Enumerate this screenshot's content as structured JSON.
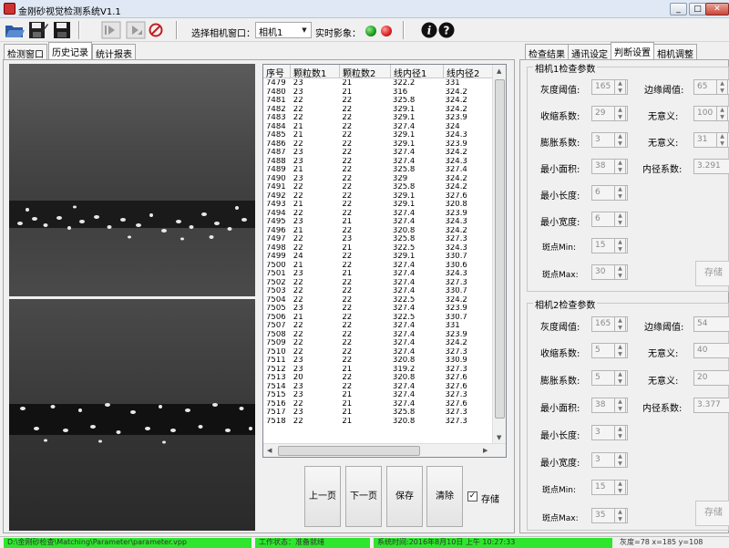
{
  "window": {
    "title": "金刚砂视觉检测系统V1.1"
  },
  "toolbar": {
    "camera_label": "选择相机窗口：",
    "camera_value": "相机1",
    "realtime_label": "实时影象："
  },
  "left_tabs": [
    "检测窗口",
    "历史记录",
    "统计报表"
  ],
  "grid": {
    "columns": [
      "序号",
      "颗粒数1",
      "颗粒数2",
      "线内径1",
      "线内径2"
    ],
    "rows": [
      [
        "7479",
        "23",
        "21",
        "322.2",
        "331"
      ],
      [
        "7480",
        "23",
        "21",
        "316",
        "324.2"
      ],
      [
        "7481",
        "22",
        "22",
        "325.8",
        "324.2"
      ],
      [
        "7482",
        "22",
        "22",
        "329.1",
        "324.2"
      ],
      [
        "7483",
        "22",
        "22",
        "329.1",
        "323.9"
      ],
      [
        "7484",
        "21",
        "22",
        "327.4",
        "324"
      ],
      [
        "7485",
        "21",
        "22",
        "329.1",
        "324.3"
      ],
      [
        "7486",
        "22",
        "22",
        "329.1",
        "323.9"
      ],
      [
        "7487",
        "23",
        "22",
        "327.4",
        "324.2"
      ],
      [
        "7488",
        "23",
        "22",
        "327.4",
        "324.3"
      ],
      [
        "7489",
        "21",
        "22",
        "325.8",
        "327.4"
      ],
      [
        "7490",
        "23",
        "22",
        "329",
        "324.2"
      ],
      [
        "7491",
        "22",
        "22",
        "325.8",
        "324.2"
      ],
      [
        "7492",
        "22",
        "22",
        "329.1",
        "327.6"
      ],
      [
        "7493",
        "21",
        "22",
        "329.1",
        "320.8"
      ],
      [
        "7494",
        "22",
        "22",
        "327.4",
        "323.9"
      ],
      [
        "7495",
        "23",
        "21",
        "327.4",
        "324.3"
      ],
      [
        "7496",
        "21",
        "22",
        "320.8",
        "324.2"
      ],
      [
        "7497",
        "22",
        "23",
        "325.8",
        "327.3"
      ],
      [
        "7498",
        "22",
        "21",
        "322.5",
        "324.3"
      ],
      [
        "7499",
        "24",
        "22",
        "329.1",
        "330.7"
      ],
      [
        "7500",
        "21",
        "22",
        "327.4",
        "330.6"
      ],
      [
        "7501",
        "23",
        "21",
        "327.4",
        "324.3"
      ],
      [
        "7502",
        "22",
        "22",
        "327.4",
        "327.3"
      ],
      [
        "7503",
        "22",
        "22",
        "327.4",
        "330.7"
      ],
      [
        "7504",
        "22",
        "22",
        "322.5",
        "324.2"
      ],
      [
        "7505",
        "23",
        "22",
        "327.4",
        "323.9"
      ],
      [
        "7506",
        "21",
        "22",
        "322.5",
        "330.7"
      ],
      [
        "7507",
        "22",
        "22",
        "327.4",
        "331"
      ],
      [
        "7508",
        "22",
        "22",
        "327.4",
        "323.9"
      ],
      [
        "7509",
        "22",
        "22",
        "327.4",
        "324.2"
      ],
      [
        "7510",
        "22",
        "22",
        "327.4",
        "327.3"
      ],
      [
        "7511",
        "23",
        "22",
        "320.8",
        "330.9"
      ],
      [
        "7512",
        "23",
        "21",
        "319.2",
        "327.3"
      ],
      [
        "7513",
        "20",
        "22",
        "320.8",
        "327.6"
      ],
      [
        "7514",
        "23",
        "22",
        "327.4",
        "327.6"
      ],
      [
        "7515",
        "23",
        "21",
        "327.4",
        "327.3"
      ],
      [
        "7516",
        "22",
        "21",
        "327.4",
        "327.6"
      ],
      [
        "7517",
        "23",
        "21",
        "325.8",
        "327.3"
      ],
      [
        "7518",
        "22",
        "21",
        "320.8",
        "327.3"
      ]
    ]
  },
  "bottom_buttons": {
    "prev": "上一页",
    "next": "下一页",
    "save": "保存",
    "clear": "清除",
    "store": "存储",
    "store_checked": true
  },
  "right_tabs": [
    "检查结果",
    "通讯设定",
    "判断设置",
    "相机调整"
  ],
  "cam1": {
    "legend": "相机1检查参数",
    "gray_label": "灰度阈值:",
    "gray_value": "165",
    "edge_label": "边缘阈值:",
    "edge_value": "65",
    "shrink_label": "收缩系数:",
    "shrink_value": "29",
    "nomean1_label": "无意义:",
    "nomean1_value": "100",
    "expand_label": "膨胀系数:",
    "expand_value": "3",
    "nomean2_label": "无意义:",
    "nomean2_value": "31",
    "minarea_label": "最小面积:",
    "minarea_value": "38",
    "innercoef_label": "内径系数:",
    "innercoef_value": "3.291",
    "minlen_label": "最小长度:",
    "minlen_value": "6",
    "minwidth_label": "最小宽度:",
    "minwidth_value": "6",
    "spotmin_label": "斑点Min:",
    "spotmin_value": "15",
    "spotmax_label": "斑点Max:",
    "spotmax_value": "30",
    "save_label": "存储"
  },
  "cam2": {
    "legend": "相机2检查参数",
    "gray_label": "灰度阈值:",
    "gray_value": "165",
    "edge_label": "边缘阈值:",
    "edge_value": "54",
    "shrink_label": "收缩系数:",
    "shrink_value": "5",
    "nomean1_label": "无意义:",
    "nomean1_value": "40",
    "expand_label": "膨胀系数:",
    "expand_value": "5",
    "nomean2_label": "无意义:",
    "nomean2_value": "20",
    "minarea_label": "最小面积:",
    "minarea_value": "38",
    "innercoef_label": "内径系数:",
    "innercoef_value": "3.377",
    "minlen_label": "最小长度:",
    "minlen_value": "3",
    "minwidth_label": "最小宽度:",
    "minwidth_value": "3",
    "spotmin_label": "斑点Min:",
    "spotmin_value": "15",
    "spotmax_label": "斑点Max:",
    "spotmax_value": "35",
    "save_label": "存储"
  },
  "status": {
    "path": "D:\\金刚砂检查\\Matching\\Parameter\\parameter.vpp",
    "mode": "工作状态：准备就绪",
    "time": "系统时间:2016年8月10日 上午 10:27:33",
    "coord": "灰度=78   x=185   y=108"
  },
  "colors": {
    "led_green": "#1c9a1c",
    "led_red": "#d82020",
    "status_green": "#2ee62e"
  }
}
